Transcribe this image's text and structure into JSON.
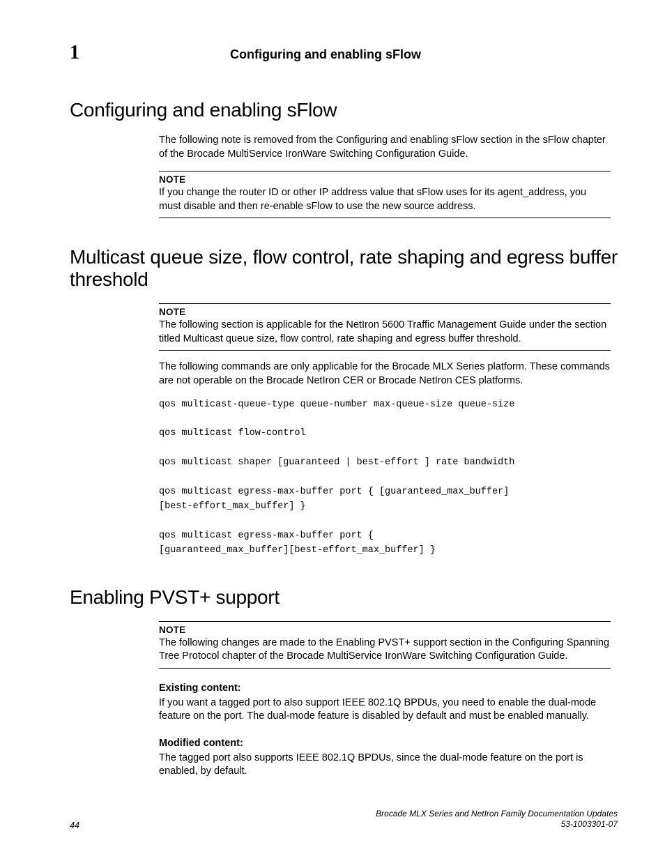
{
  "header": {
    "chapter_number": "1",
    "running_title": "Configuring and enabling sFlow"
  },
  "sections": {
    "sflow": {
      "title": "Configuring and enabling sFlow",
      "intro": "The following note is removed from the Configuring and enabling sFlow section in the sFlow chapter of the Brocade MultiService IronWare Switching Configuration Guide.",
      "note_label": "NOTE",
      "note_body": "If you change the router ID or other IP address value that sFlow uses for its agent_address, you must disable and then re-enable sFlow to use the new source address."
    },
    "multicast": {
      "title": "Multicast queue size, flow control, rate shaping and egress buffer threshold",
      "note_label": "NOTE",
      "note_body": "The following section is applicable for the NetIron 5600 Traffic Management Guide under the section titled Multicast queue size, flow control, rate shaping and egress buffer threshold.",
      "para": "The following commands are only applicable for the Brocade MLX Series platform. These commands are not operable on the Brocade NetIron CER or Brocade NetIron CES platforms.",
      "code": "qos multicast-queue-type queue-number max-queue-size queue-size\n\nqos multicast flow-control\n\nqos multicast shaper [guaranteed | best-effort ] rate bandwidth\n\nqos multicast egress-max-buffer port { [guaranteed_max_buffer]\n[best-effort_max_buffer] }\n\nqos multicast egress-max-buffer port {\n[guaranteed_max_buffer][best-effort_max_buffer] }"
    },
    "pvst": {
      "title": "Enabling PVST+ support",
      "note_label": "NOTE",
      "note_body": "The following changes are made to the Enabling PVST+ support section in the Configuring Spanning Tree Protocol chapter of the Brocade MultiService IronWare Switching Configuration Guide.",
      "existing_label": "Existing content:",
      "existing_body": "If you want a tagged port to also support IEEE 802.1Q BPDUs, you need to enable the dual-mode feature on the port. The dual-mode feature is disabled by default and must be enabled manually.",
      "modified_label": "Modified content:",
      "modified_body": "The tagged port also supports IEEE 802.1Q BPDUs, since the dual-mode feature on the port is enabled, by default."
    }
  },
  "footer": {
    "page_number": "44",
    "doc_title": "Brocade MLX Series and NetIron Family Documentation Updates",
    "doc_id": "53-1003301-07"
  }
}
